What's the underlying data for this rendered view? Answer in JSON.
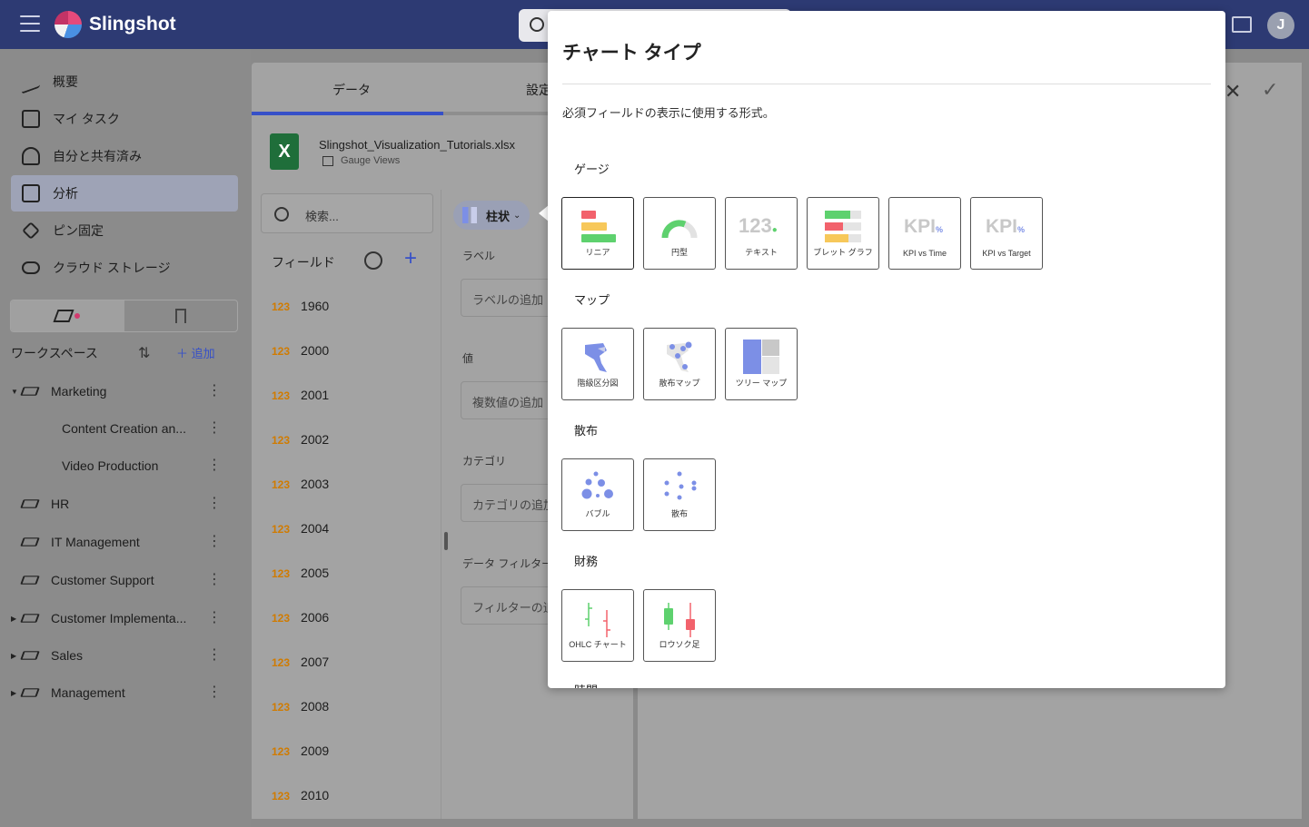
{
  "app": {
    "name": "Slingshot",
    "avatar_initial": "J"
  },
  "sidebar": {
    "nav": [
      {
        "label": "概要",
        "icon": "activity-icon"
      },
      {
        "label": "マイ タスク",
        "icon": "task-icon"
      },
      {
        "label": "自分と共有済み",
        "icon": "shared-user-icon"
      },
      {
        "label": "分析",
        "icon": "analytics-icon",
        "active": true
      },
      {
        "label": "ピン固定",
        "icon": "pin-icon"
      },
      {
        "label": "クラウド ストレージ",
        "icon": "cloud-icon"
      }
    ],
    "workspaces_title": "ワークスペース",
    "add_label": "追加",
    "workspaces": [
      {
        "label": "Marketing",
        "expanded": true
      },
      {
        "label": "Content Creation an...",
        "child": true
      },
      {
        "label": "Video Production",
        "child": true
      },
      {
        "label": "HR"
      },
      {
        "label": "IT Management"
      },
      {
        "label": "Customer Support"
      },
      {
        "label": "Customer Implementa..."
      },
      {
        "label": "Sales"
      },
      {
        "label": "Management"
      }
    ]
  },
  "panel": {
    "tab_data": "データ",
    "tab_settings": "設定",
    "file_name": "Slingshot_Visualization_Tutorials.xlsx",
    "sheet_name": "Gauge Views",
    "xl_letter": "X",
    "search_placeholder": "検索...",
    "fields_title": "フィールド",
    "field_type": "123",
    "fields": [
      "1960",
      "2000",
      "2001",
      "2002",
      "2003",
      "2004",
      "2005",
      "2006",
      "2007",
      "2008",
      "2009",
      "2010"
    ],
    "chart_type_button": "柱状",
    "label_section": "ラベル",
    "label_placeholder": "ラベルの追加",
    "value_section": "値",
    "value_placeholder": "複数値の追加",
    "category_section": "カテゴリ",
    "category_placeholder": "カテゴリの追加",
    "filter_section": "データ フィルター",
    "filter_placeholder": "フィルターの追加"
  },
  "modal": {
    "title": "チャート タイプ",
    "subtitle": "必須フィールドの表示に使用する形式。",
    "categories": [
      {
        "name": "ゲージ",
        "items": [
          "リニア",
          "円型",
          "テキスト",
          "ブレット グラフ",
          "KPI vs Time",
          "KPI vs Target"
        ]
      },
      {
        "name": "マップ",
        "items": [
          "階級区分図",
          "散布マップ",
          "ツリー マップ"
        ]
      },
      {
        "name": "散布",
        "items": [
          "バブル",
          "散布"
        ]
      },
      {
        "name": "財務",
        "items": [
          "OHLC チャート",
          "ロウソク足"
        ]
      }
    ],
    "next_category_partial": "時間",
    "card_art_text": {
      "text_gauge": "123",
      "kpi": "KPI",
      "percent": "%"
    }
  },
  "colors": {
    "accent": "#3650c8",
    "topbar": "#2d3a73",
    "red": "#f2626c",
    "yellow": "#f7c85a",
    "green": "#5ed16e",
    "blue": "#7c8fe6"
  }
}
